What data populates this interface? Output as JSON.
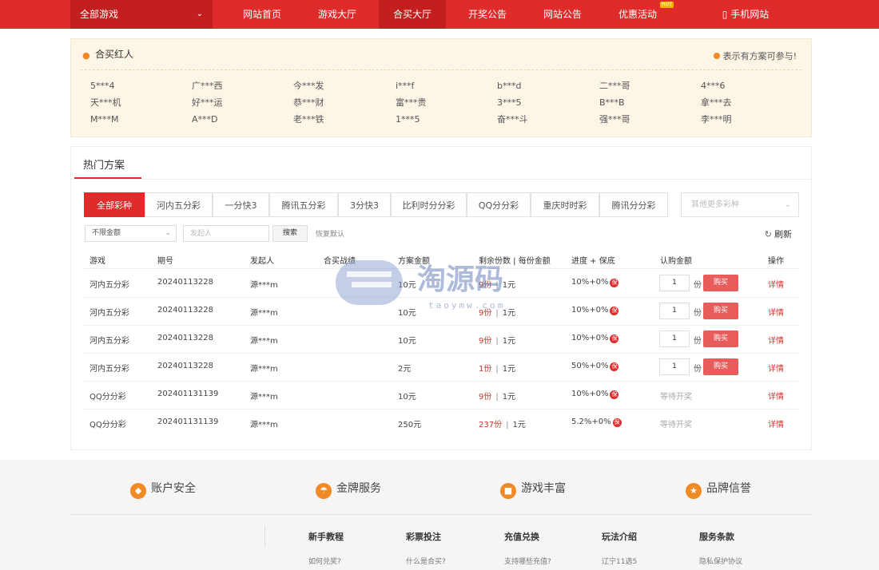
{
  "nav": {
    "all_games": "全部游戏",
    "items": [
      {
        "label": "网站首页"
      },
      {
        "label": "游戏大厅"
      },
      {
        "label": "合买大厅"
      },
      {
        "label": "开奖公告"
      },
      {
        "label": "网站公告"
      },
      {
        "label": "优惠活动"
      },
      {
        "label": "手机网站"
      }
    ],
    "hot_badge": "HOT"
  },
  "red_people": {
    "title": "合买红人",
    "note": "表示有方案可参与!",
    "names": [
      [
        "5***4",
        "广***西",
        "今***发",
        "i***f",
        "b***d",
        "二***哥",
        "4***6"
      ],
      [
        "天***机",
        "好***运",
        "恭***财",
        "富***贵",
        "3***5",
        "B***B",
        "拿***去"
      ],
      [
        "M***M",
        "A***D",
        "老***铁",
        "1***5",
        "奋***斗",
        "强***哥",
        "李***明"
      ]
    ]
  },
  "hot_plans": {
    "title": "热门方案",
    "tabs": [
      "全部彩种",
      "河内五分彩",
      "一分快3",
      "腾讯五分彩",
      "3分快3",
      "比利时分分彩",
      "QQ分分彩",
      "重庆时时彩",
      "腾讯分分彩"
    ],
    "more_placeholder": "其他更多彩种",
    "filter": {
      "amount_select": "不限金额",
      "initiator_placeholder": "发起人",
      "search_label": "搜索",
      "reset_label": "恢复默认",
      "refresh_label": "刷新"
    },
    "columns": [
      "游戏",
      "期号",
      "发起人",
      "合买战绩",
      "方案金额",
      "剩余份数 | 每份金额",
      "进度 + 保底",
      "认购金额",
      "操作"
    ],
    "rows": [
      {
        "game": "河内五分彩",
        "issue": "20240113228",
        "initiator": "源***m",
        "amount": "10元",
        "remaining": "9份",
        "per_share": "1元",
        "progress": "10%+0%",
        "qty": "1",
        "unit": "份",
        "buy": "购买",
        "detail": "详情"
      },
      {
        "game": "河内五分彩",
        "issue": "20240113228",
        "initiator": "源***m",
        "amount": "10元",
        "remaining": "9份",
        "per_share": "1元",
        "progress": "10%+0%",
        "qty": "1",
        "unit": "份",
        "buy": "购买",
        "detail": "详情"
      },
      {
        "game": "河内五分彩",
        "issue": "20240113228",
        "initiator": "源***m",
        "amount": "10元",
        "remaining": "9份",
        "per_share": "1元",
        "progress": "10%+0%",
        "qty": "1",
        "unit": "份",
        "buy": "购买",
        "detail": "详情"
      },
      {
        "game": "河内五分彩",
        "issue": "20240113228",
        "initiator": "源***m",
        "amount": "2元",
        "remaining": "1份",
        "per_share": "1元",
        "progress": "50%+0%",
        "qty": "1",
        "unit": "份",
        "buy": "购买",
        "detail": "详情"
      },
      {
        "game": "QQ分分彩",
        "issue": "202401131139",
        "initiator": "源***m",
        "amount": "10元",
        "remaining": "9份",
        "per_share": "1元",
        "progress": "10%+0%",
        "status": "等待开奖",
        "detail": "详情"
      },
      {
        "game": "QQ分分彩",
        "issue": "202401131139",
        "initiator": "源***m",
        "amount": "250元",
        "remaining": "237份",
        "per_share": "1元",
        "progress": "5.2%+0%",
        "status": "等待开奖",
        "detail": "详情"
      }
    ],
    "bao_label": "保",
    "separator": "|"
  },
  "watermark": {
    "text": "淘源码",
    "sub": "taoymw.com"
  },
  "footer": {
    "features": [
      {
        "label": "账户安全",
        "icon": "shield-icon"
      },
      {
        "label": "金牌服务",
        "icon": "umbrella-icon"
      },
      {
        "label": "游戏丰富",
        "icon": "gamepad-icon"
      },
      {
        "label": "品牌信誉",
        "icon": "medal-icon"
      }
    ],
    "columns": [
      {
        "title": "新手教程",
        "link": "如何兑奖?"
      },
      {
        "title": "彩票投注",
        "link": "什么是合买?"
      },
      {
        "title": "充值兑换",
        "link": "支持哪些充值?"
      },
      {
        "title": "玩法介绍",
        "link": "辽宁11选5"
      },
      {
        "title": "服务条款",
        "link": "隐私保护协议"
      }
    ]
  },
  "colors": {
    "brand_red": "#e02b2b",
    "dark_red": "#c41f1f",
    "orange": "#f08a24",
    "panel_bg": "#fdf5e6"
  }
}
